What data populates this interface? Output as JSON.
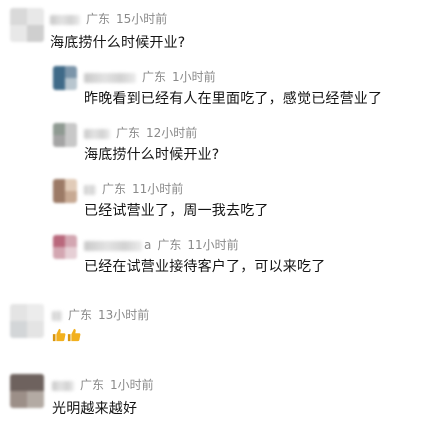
{
  "comments": [
    {
      "location": "广东",
      "time": "15小时前",
      "text": "海底捞什么时候开业?"
    },
    {
      "location": "广东",
      "time": "1小时前",
      "text": "昨晚看到已经有人在里面吃了，感觉已经营业了"
    },
    {
      "location": "广东",
      "time": "12小时前",
      "text": "海底捞什么时候开业?"
    },
    {
      "location": "广东",
      "time": "11小时前",
      "text": "已经试营业了，周一我去吃了"
    },
    {
      "location": "广东",
      "time": "11小时前",
      "name_tail": "a",
      "text": "已经在试营业接待客户了，可以来吃了"
    },
    {
      "location": "广东",
      "time": "13小时前",
      "icon": "thumbs-up-icon"
    },
    {
      "location": "广东",
      "time": "1小时前",
      "text": "光明越来越好"
    }
  ],
  "colors": {
    "meta": "#8a8a8a",
    "text": "#141414",
    "thumb": "#f2b01e"
  }
}
